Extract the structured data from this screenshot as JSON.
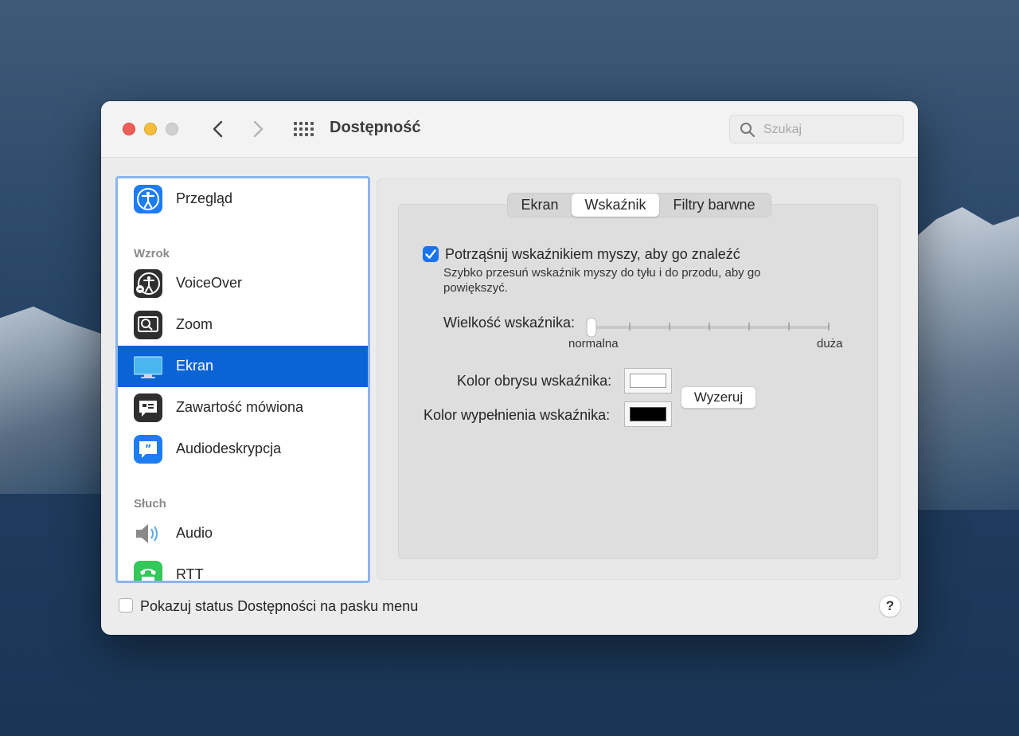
{
  "window": {
    "title": "Dostępność",
    "search_placeholder": "Szukaj"
  },
  "sidebar": {
    "items": [
      {
        "label": "Przegląd",
        "icon": "accessibility-icon"
      },
      {
        "label": "VoiceOver",
        "icon": "voiceover-icon"
      },
      {
        "label": "Zoom",
        "icon": "zoom-icon"
      },
      {
        "label": "Ekran",
        "icon": "display-icon",
        "selected": true
      },
      {
        "label": "Zawartość mówiona",
        "icon": "spoken-content-icon"
      },
      {
        "label": "Audiodeskrypcja",
        "icon": "audio-description-icon"
      },
      {
        "label": "Audio",
        "icon": "speaker-icon"
      },
      {
        "label": "RTT",
        "icon": "rtt-icon"
      }
    ],
    "sections": {
      "vision": "Wzrok",
      "hearing": "Słuch"
    }
  },
  "tabs": [
    {
      "label": "Ekran"
    },
    {
      "label": "Wskaźnik",
      "selected": true
    },
    {
      "label": "Filtry barwne"
    }
  ],
  "pointer": {
    "shake_checked": true,
    "shake_label": "Potrząśnij wskaźnikiem myszy, aby go znaleźć",
    "shake_description": "Szybko przesuń wskaźnik myszy do tyłu i do przodu, aby go powiększyć.",
    "size_label": "Wielkość wskaźnika:",
    "size_min_label": "normalna",
    "size_max_label": "duża",
    "size_value": 0,
    "outline_label": "Kolor obrysu wskaźnika:",
    "outline_color": "#ffffff",
    "fill_label": "Kolor wypełnienia wskaźnika:",
    "fill_color": "#000000",
    "reset_label": "Wyzeruj"
  },
  "footer": {
    "menu_status_checked": false,
    "menu_status_label": "Pokazuj status Dostępności na pasku menu",
    "help_label": "?"
  },
  "colors": {
    "accent": "#0a64d6",
    "checkbox": "#1a73e8"
  }
}
